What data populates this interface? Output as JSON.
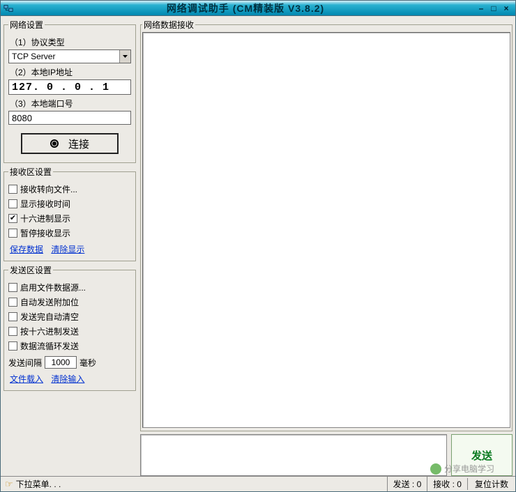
{
  "window": {
    "title": "网络调试助手  (CM精装版  V3.8.2)"
  },
  "net_settings": {
    "legend": "网络设置",
    "protocol_label": "（1）协议类型",
    "protocol_value": "TCP Server",
    "ip_label": "（2）本地IP地址",
    "ip_value": "127. 0 . 0 . 1",
    "port_label": "（3）本地端口号",
    "port_value": "8080",
    "connect_label": "连接"
  },
  "recv_settings": {
    "legend": "接收区设置",
    "items": [
      {
        "label": "接收转向文件...",
        "checked": false
      },
      {
        "label": "显示接收时间",
        "checked": false
      },
      {
        "label": "十六进制显示",
        "checked": true
      },
      {
        "label": "暂停接收显示",
        "checked": false
      }
    ],
    "save_link": "保存数据",
    "clear_link": "清除显示"
  },
  "send_settings": {
    "legend": "发送区设置",
    "items": [
      {
        "label": "启用文件数据源...",
        "checked": false
      },
      {
        "label": "自动发送附加位",
        "checked": false
      },
      {
        "label": "发送完自动清空",
        "checked": false
      },
      {
        "label": "按十六进制发送",
        "checked": false
      },
      {
        "label": "数据流循环发送",
        "checked": false
      }
    ],
    "interval_prefix": "发送间隔",
    "interval_value": "1000",
    "interval_suffix": "毫秒",
    "load_link": "文件载入",
    "clear_link": "清除输入"
  },
  "recv_panel": {
    "legend": "网络数据接收"
  },
  "send_panel": {
    "button": "发送"
  },
  "status": {
    "menu": "下拉菜单. . .",
    "sent_label": "发送 :",
    "sent_value": "0",
    "recv_label": "接收 :",
    "recv_value": "0",
    "reset": "复位计数"
  },
  "watermark": "分享电脑学习"
}
